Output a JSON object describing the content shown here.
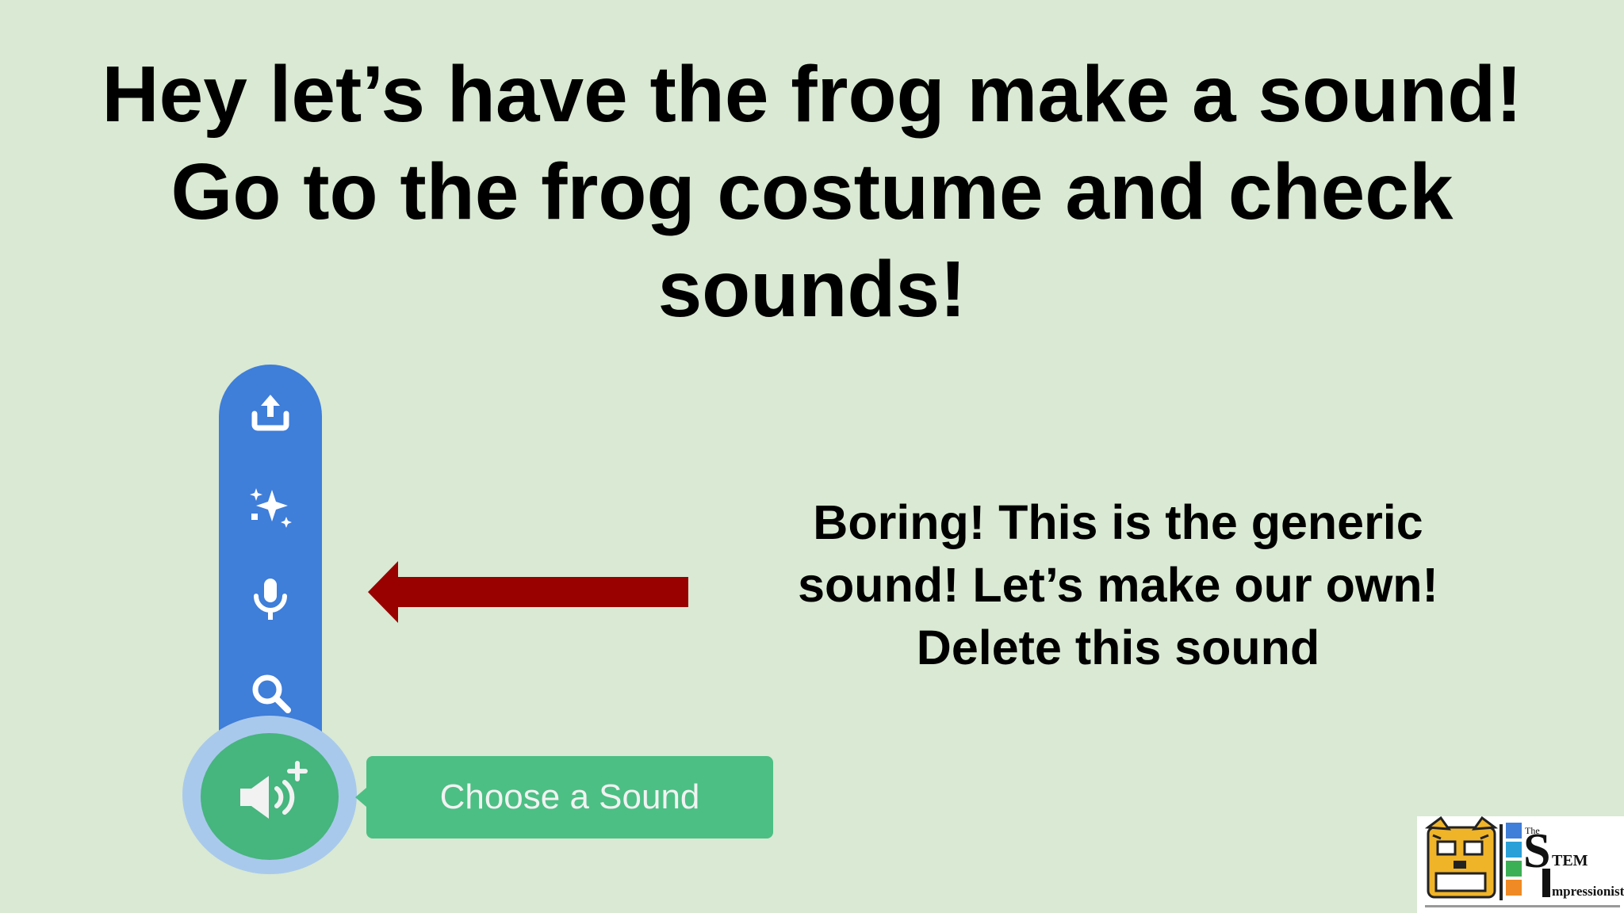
{
  "slide": {
    "title_lines": [
      "Hey let’s have the frog make a sound!",
      "Go to the frog costume and check",
      "sounds!"
    ],
    "callout_lines": [
      "Boring! This is the generic",
      "sound! Let’s make our own!",
      "Delete this sound"
    ]
  },
  "sound_menu": {
    "icons": [
      "upload-icon",
      "sparkle-icon",
      "microphone-icon",
      "search-icon"
    ],
    "main_button_icon": "speaker-plus-icon",
    "tooltip_label": "Choose a Sound"
  },
  "logo": {
    "text_the": "The",
    "text_stem": "TEM",
    "text_impressionists": "mpressionists",
    "icon": "tiger-mascot-icon"
  },
  "colors": {
    "background": "#d9e9d3",
    "toolbar_blue": "#3f7ed9",
    "button_green": "#46b57e",
    "tooltip_green": "#4cbf84",
    "arrow_red": "#990000"
  }
}
